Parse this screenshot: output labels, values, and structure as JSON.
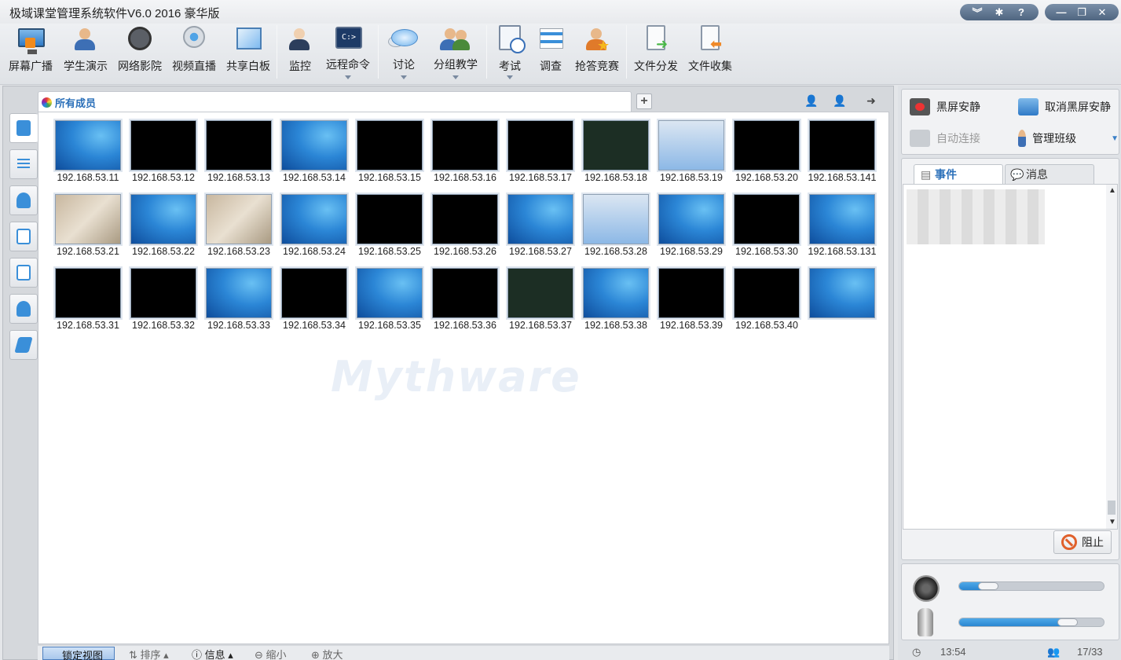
{
  "window": {
    "title": "极域课堂管理系统软件V6.0 2016 豪华版",
    "title_buttons_left": [
      "︾",
      "✱",
      "?"
    ],
    "title_buttons_right": [
      "—",
      "❐",
      "✕"
    ]
  },
  "toolbar": {
    "buttons": [
      {
        "label": "屏幕广播",
        "icon": "screen-broadcast-icon"
      },
      {
        "label": "学生演示",
        "icon": "student-demo-icon"
      },
      {
        "label": "网络影院",
        "icon": "film-reel-icon"
      },
      {
        "label": "视频直播",
        "icon": "webcam-icon"
      },
      {
        "label": "共享白板",
        "icon": "whiteboard-icon"
      },
      {
        "label": "监控",
        "icon": "monitor-person-icon"
      },
      {
        "label": "远程命令",
        "icon": "command-prompt-icon",
        "cmd_text": "C:>"
      },
      {
        "label": "讨论",
        "icon": "chat-bubbles-icon"
      },
      {
        "label": "分组教学",
        "icon": "group-teaching-icon"
      },
      {
        "label": "考试",
        "icon": "exam-clock-icon"
      },
      {
        "label": "调查",
        "icon": "survey-bars-icon"
      },
      {
        "label": "抢答竞赛",
        "icon": "quiz-star-icon"
      },
      {
        "label": "文件分发",
        "icon": "file-send-icon"
      },
      {
        "label": "文件收集",
        "icon": "file-collect-icon"
      }
    ]
  },
  "members": {
    "tab_label": "所有成员",
    "add_tab": "+",
    "watermark": "Mythware",
    "students": [
      {
        "ip": "192.168.53.11",
        "screen": "win7"
      },
      {
        "ip": "192.168.53.12",
        "screen": "black"
      },
      {
        "ip": "192.168.53.13",
        "screen": "black"
      },
      {
        "ip": "192.168.53.14",
        "screen": "win7"
      },
      {
        "ip": "192.168.53.15",
        "screen": "black"
      },
      {
        "ip": "192.168.53.16",
        "screen": "black"
      },
      {
        "ip": "192.168.53.17",
        "screen": "black"
      },
      {
        "ip": "192.168.53.18",
        "screen": "dark"
      },
      {
        "ip": "192.168.53.19",
        "screen": "app"
      },
      {
        "ip": "192.168.53.20",
        "screen": "black"
      },
      {
        "ip": "192.168.53.141",
        "screen": "black"
      },
      {
        "ip": "192.168.53.21",
        "screen": "photo"
      },
      {
        "ip": "192.168.53.22",
        "screen": "win7"
      },
      {
        "ip": "192.168.53.23",
        "screen": "photo"
      },
      {
        "ip": "192.168.53.24",
        "screen": "win7"
      },
      {
        "ip": "192.168.53.25",
        "screen": "black"
      },
      {
        "ip": "192.168.53.26",
        "screen": "black"
      },
      {
        "ip": "192.168.53.27",
        "screen": "win7"
      },
      {
        "ip": "192.168.53.28",
        "screen": "app"
      },
      {
        "ip": "192.168.53.29",
        "screen": "win7"
      },
      {
        "ip": "192.168.53.30",
        "screen": "black"
      },
      {
        "ip": "192.168.53.131",
        "screen": "win7"
      },
      {
        "ip": "192.168.53.31",
        "screen": "black"
      },
      {
        "ip": "192.168.53.32",
        "screen": "black"
      },
      {
        "ip": "192.168.53.33",
        "screen": "win7"
      },
      {
        "ip": "192.168.53.34",
        "screen": "black"
      },
      {
        "ip": "192.168.53.35",
        "screen": "win7"
      },
      {
        "ip": "192.168.53.36",
        "screen": "black"
      },
      {
        "ip": "192.168.53.37",
        "screen": "dark"
      },
      {
        "ip": "192.168.53.38",
        "screen": "win7"
      },
      {
        "ip": "192.168.53.39",
        "screen": "black"
      },
      {
        "ip": "192.168.53.40",
        "screen": "black"
      },
      {
        "ip": "",
        "screen": "win7"
      }
    ]
  },
  "bottom_bar": {
    "lock_view": "锁定视图",
    "sort": "排序",
    "info": "信息",
    "zoom_out": "缩小",
    "zoom_in": "放大"
  },
  "right_panel": {
    "black_screen": "黑屏安静",
    "cancel_black_screen": "取消黑屏安静",
    "auto_connect": "自动连接",
    "manage_class": "管理班级",
    "tab_events": "事件",
    "tab_messages": "消息",
    "stop_button": "阻止",
    "speaker_volume_fraction": 0.2,
    "mic_volume_fraction": 0.75,
    "time": "13:54",
    "online_count": "17/33"
  }
}
